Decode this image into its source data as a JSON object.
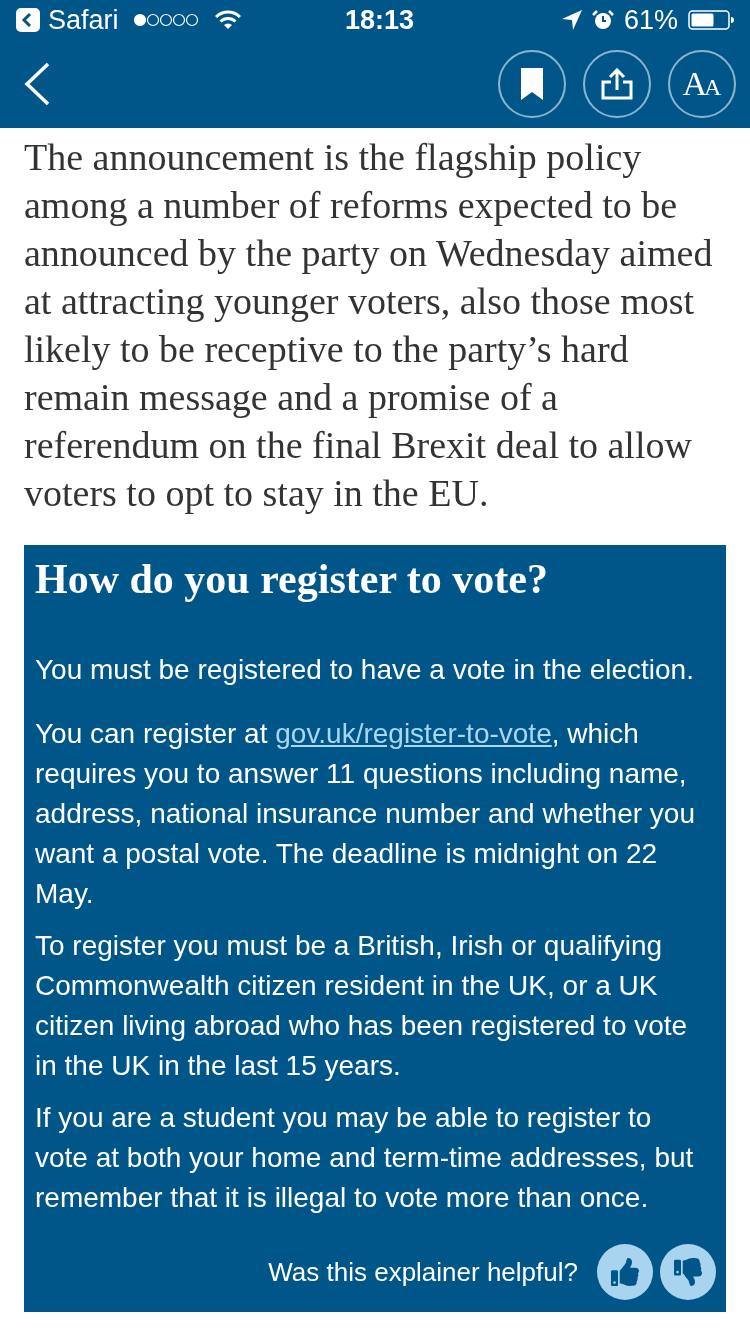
{
  "status_bar": {
    "back_app": "Safari",
    "time": "18:13",
    "battery": "61%"
  },
  "toolbar": {
    "buttons": [
      {
        "kind": "bookmark"
      },
      {
        "kind": "share"
      },
      {
        "kind": "text_size",
        "glyphs": [
          "A",
          "A"
        ]
      }
    ]
  },
  "article": {
    "paragraph": "The announcement is the flagship policy among a number of reforms expected to be announced by the party on Wednesday aimed at attracting younger voters, also those most likely to be receptive to the party’s hard remain message and a promise of a referendum on the final Brexit deal to allow voters to opt to stay in the EU."
  },
  "explainer": {
    "title": "How do you register to vote?",
    "paragraphs": [
      {
        "text": "You must be registered to have a vote in the election."
      },
      {
        "text": "You can register at ",
        "link": "gov.uk/register-to-vote",
        "after": ", which requires you to answer 11 questions including name, address, national insurance number and whether you want a postal vote. The deadline is midnight on 22 May."
      },
      {
        "text": "To register you must be a British, Irish or qualifying Commonwealth citizen resident in the UK, or a UK citizen living abroad who has been registered to vote in the UK in the last 15 years."
      },
      {
        "text": "If you are a student you may be able to register to vote at both your home and term-time addresses, but remember that it is illegal to vote more than once."
      }
    ],
    "feedback": {
      "question": "Was this explainer helpful?",
      "buttons": [
        {
          "kind": "thumbs_up"
        },
        {
          "kind": "thumbs_down"
        }
      ]
    }
  }
}
